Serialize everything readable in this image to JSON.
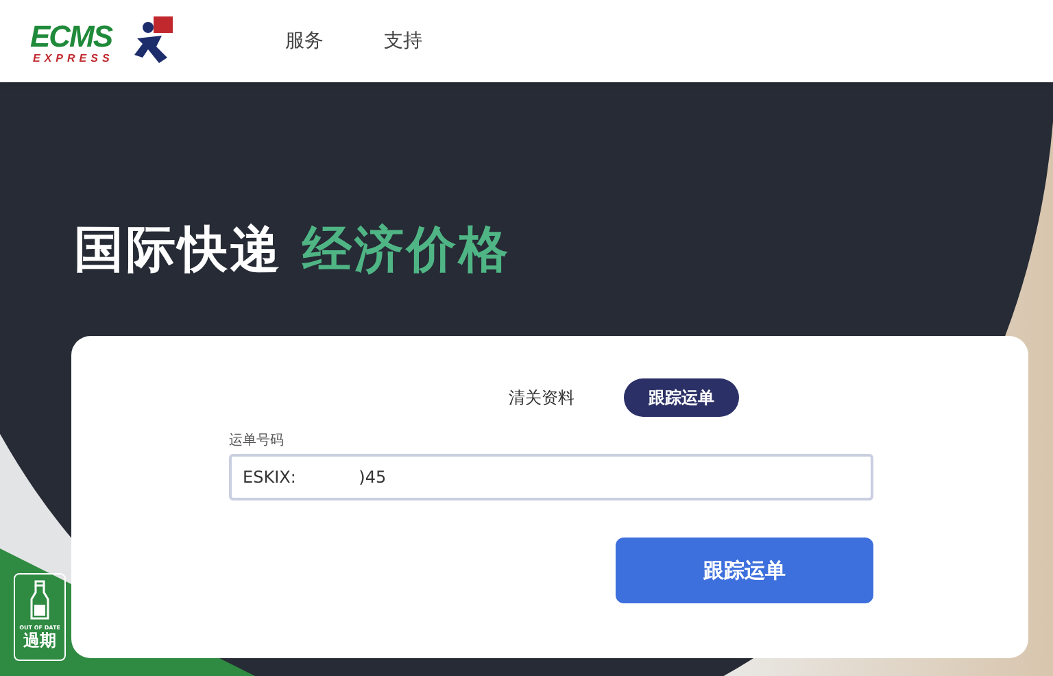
{
  "header": {
    "logo": {
      "name": "ECMS",
      "tagline": "EXPRESS"
    },
    "nav": [
      {
        "label": "服务"
      },
      {
        "label": "支持"
      }
    ]
  },
  "hero": {
    "title": "国际快递",
    "title_highlight": "经济价格"
  },
  "tracking_card": {
    "tabs": [
      {
        "label": "清关资料",
        "selected": false
      },
      {
        "label": "跟踪运单",
        "selected": true
      }
    ],
    "field": {
      "label": "运单号码",
      "value": "ESKIX:            )45"
    },
    "submit": "跟踪运单"
  },
  "sticker": {
    "caption": "OUT OF DATE",
    "label": "過期"
  }
}
